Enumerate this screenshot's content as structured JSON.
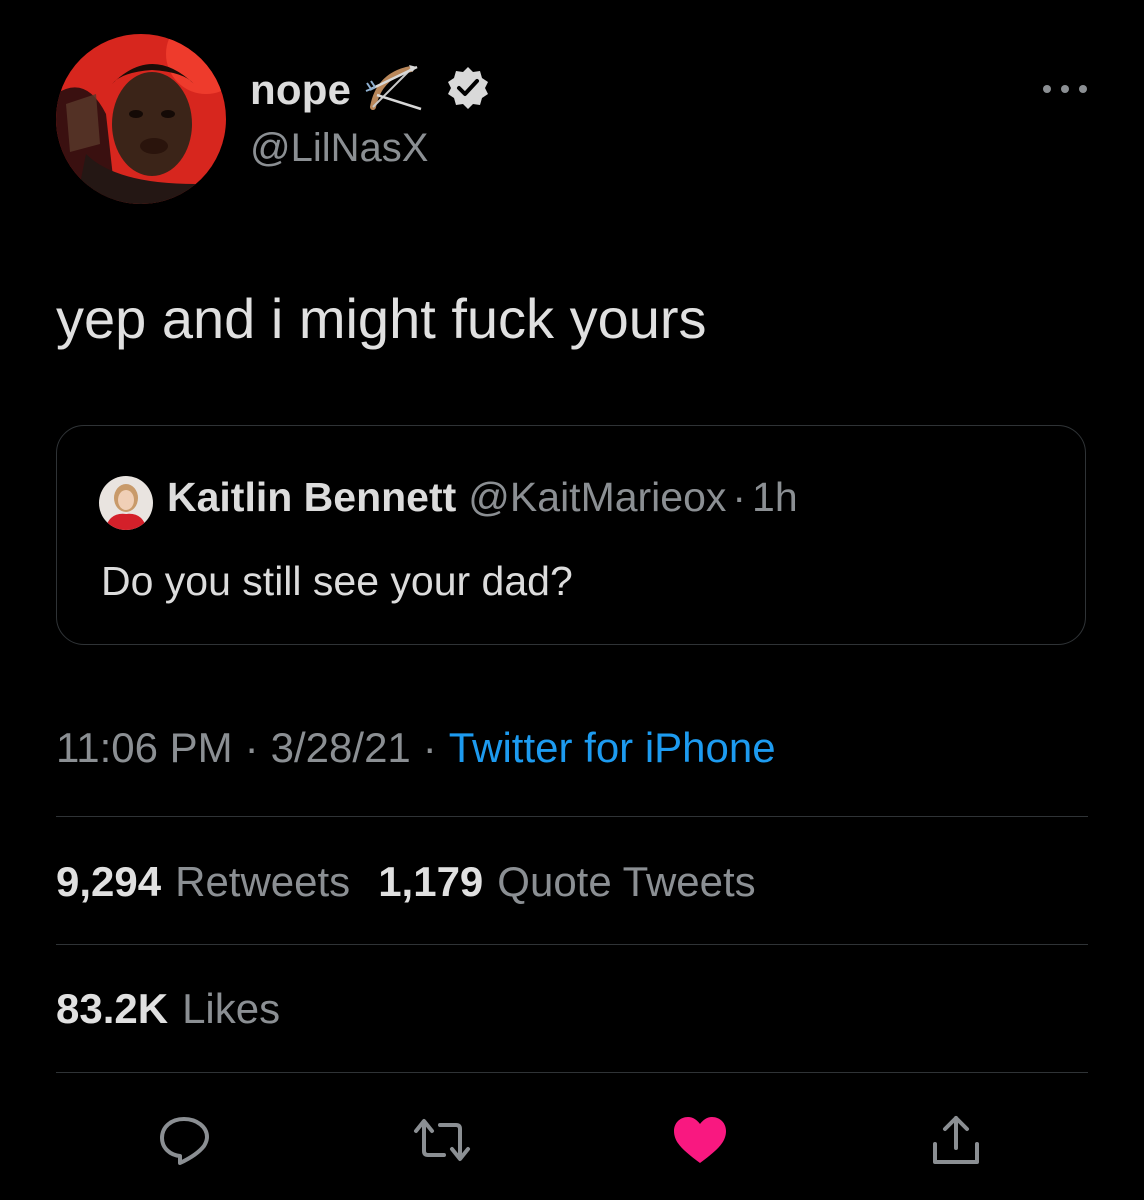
{
  "author": {
    "display_name": "nope",
    "handle": "@LilNasX",
    "emoji_icon": "bow-and-arrow-icon",
    "verified": true
  },
  "tweet": {
    "text": "yep and i might fuck yours"
  },
  "quoted_tweet": {
    "display_name": "Kaitlin Bennett",
    "handle": "@KaitMarieox",
    "separator": "·",
    "time": "1h",
    "text": "Do you still see your dad?"
  },
  "meta": {
    "time": "11:06 PM",
    "separator": "·",
    "date": "3/28/21",
    "source": "Twitter for iPhone"
  },
  "stats": {
    "retweets_count": "9,294",
    "retweets_label": "Retweets",
    "quotes_count": "1,179",
    "quotes_label": "Quote Tweets",
    "likes_count": "83.2K",
    "likes_label": "Likes"
  },
  "colors": {
    "background": "#000000",
    "link": "#1d9bf0",
    "like_active": "#f91880",
    "muted": "#8b8f93",
    "divider": "#2f3336"
  },
  "actions": {
    "reply_icon": "reply-icon",
    "retweet_icon": "retweet-icon",
    "like_icon": "heart-icon",
    "like_state": "liked",
    "share_icon": "share-icon"
  }
}
